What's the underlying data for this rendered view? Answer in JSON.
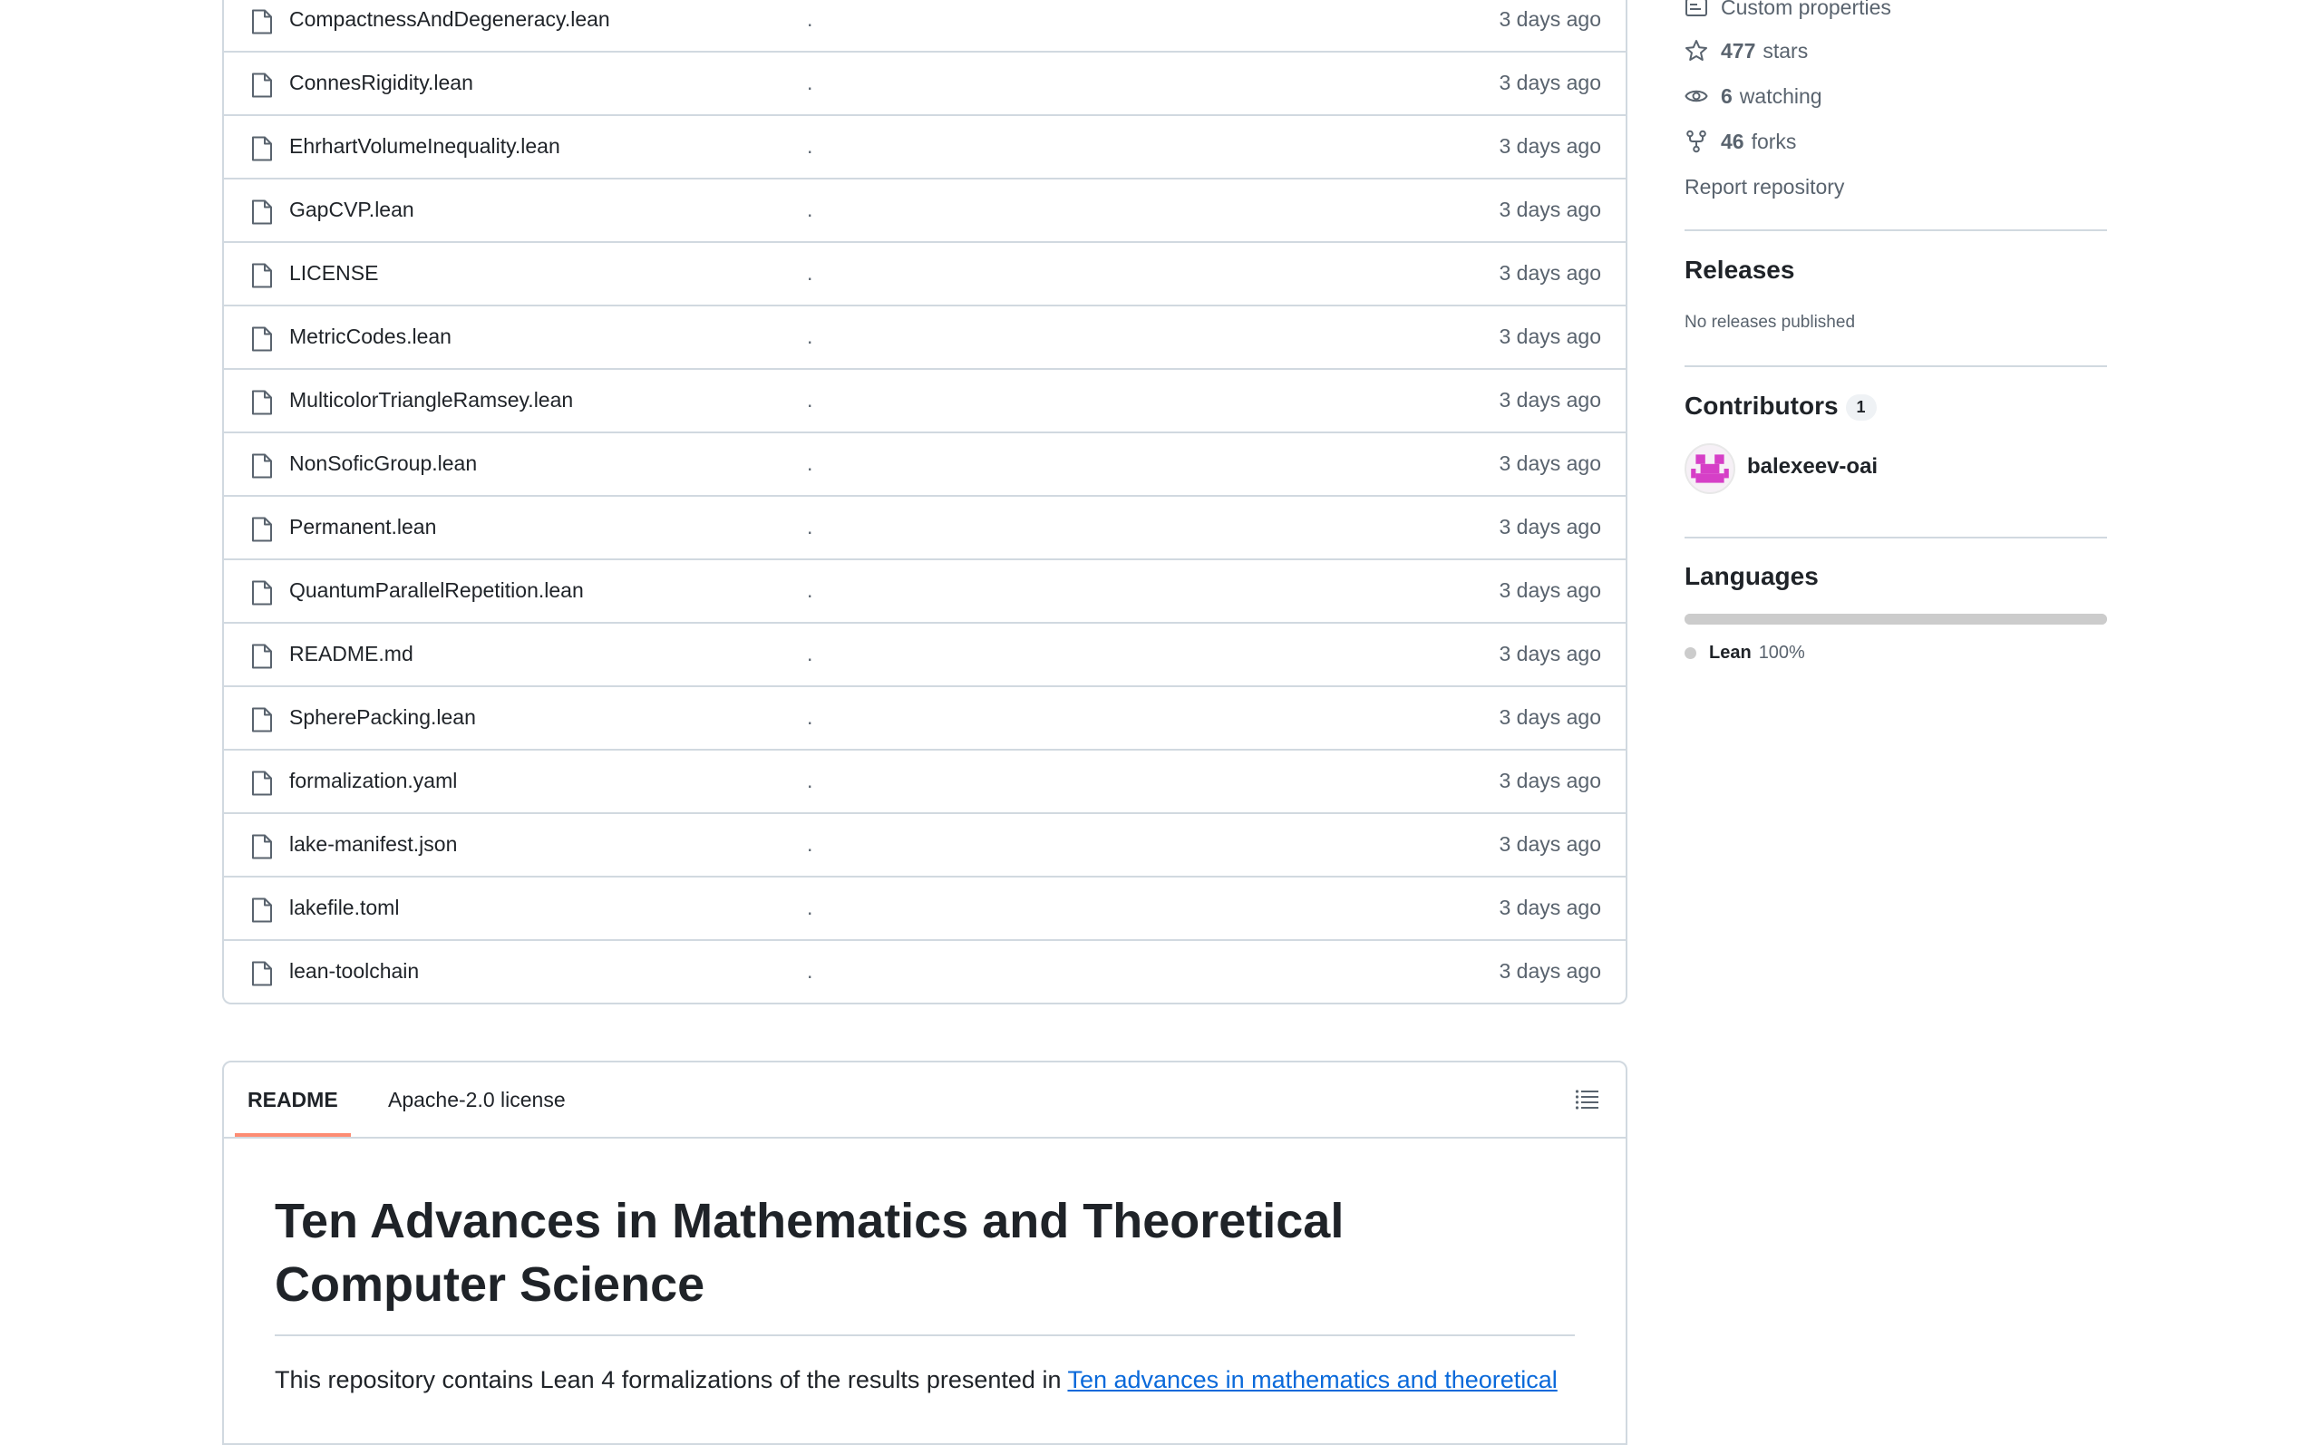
{
  "files": [
    {
      "name": "CompactnessAndDegeneracy.lean",
      "message": ".",
      "time": "3 days ago"
    },
    {
      "name": "ConnesRigidity.lean",
      "message": ".",
      "time": "3 days ago"
    },
    {
      "name": "EhrhartVolumeInequality.lean",
      "message": ".",
      "time": "3 days ago"
    },
    {
      "name": "GapCVP.lean",
      "message": ".",
      "time": "3 days ago"
    },
    {
      "name": "LICENSE",
      "message": ".",
      "time": "3 days ago"
    },
    {
      "name": "MetricCodes.lean",
      "message": ".",
      "time": "3 days ago"
    },
    {
      "name": "MulticolorTriangleRamsey.lean",
      "message": ".",
      "time": "3 days ago"
    },
    {
      "name": "NonSoficGroup.lean",
      "message": ".",
      "time": "3 days ago"
    },
    {
      "name": "Permanent.lean",
      "message": ".",
      "time": "3 days ago"
    },
    {
      "name": "QuantumParallelRepetition.lean",
      "message": ".",
      "time": "3 days ago"
    },
    {
      "name": "README.md",
      "message": ".",
      "time": "3 days ago"
    },
    {
      "name": "SpherePacking.lean",
      "message": ".",
      "time": "3 days ago"
    },
    {
      "name": "formalization.yaml",
      "message": ".",
      "time": "3 days ago"
    },
    {
      "name": "lake-manifest.json",
      "message": ".",
      "time": "3 days ago"
    },
    {
      "name": "lakefile.toml",
      "message": ".",
      "time": "3 days ago"
    },
    {
      "name": "lean-toolchain",
      "message": ".",
      "time": "3 days ago"
    }
  ],
  "readme": {
    "tab_readme": "README",
    "tab_license": "Apache-2.0 license",
    "title_line1": "Ten Advances in Mathematics and Theoretical",
    "title_line2": "Computer Science",
    "para_prefix": "This repository contains Lean 4 formalizations of the results presented in ",
    "para_link": "Ten advances in mathematics and theoretical"
  },
  "sidebar": {
    "custom_properties": "Custom properties",
    "stars_count": "477",
    "stars_label": "stars",
    "watching_count": "6",
    "watching_label": "watching",
    "forks_count": "46",
    "forks_label": "forks",
    "report": "Report repository",
    "releases_heading": "Releases",
    "releases_note": "No releases published",
    "contributors_heading": "Contributors",
    "contributors_count": "1",
    "contributor_name": "balexeev-oai",
    "languages_heading": "Languages",
    "language_name": "Lean",
    "language_pct": "100%",
    "language_share": 1.0
  },
  "colors": {
    "accent_link": "#0969da",
    "tab_underline": "#fd8c73",
    "lean_language": "#cccccc",
    "avatar_identicon": "#d63fc7"
  },
  "icons": [
    "file-icon",
    "outline-list-icon",
    "property-icon",
    "star-icon",
    "eye-icon",
    "fork-icon"
  ]
}
